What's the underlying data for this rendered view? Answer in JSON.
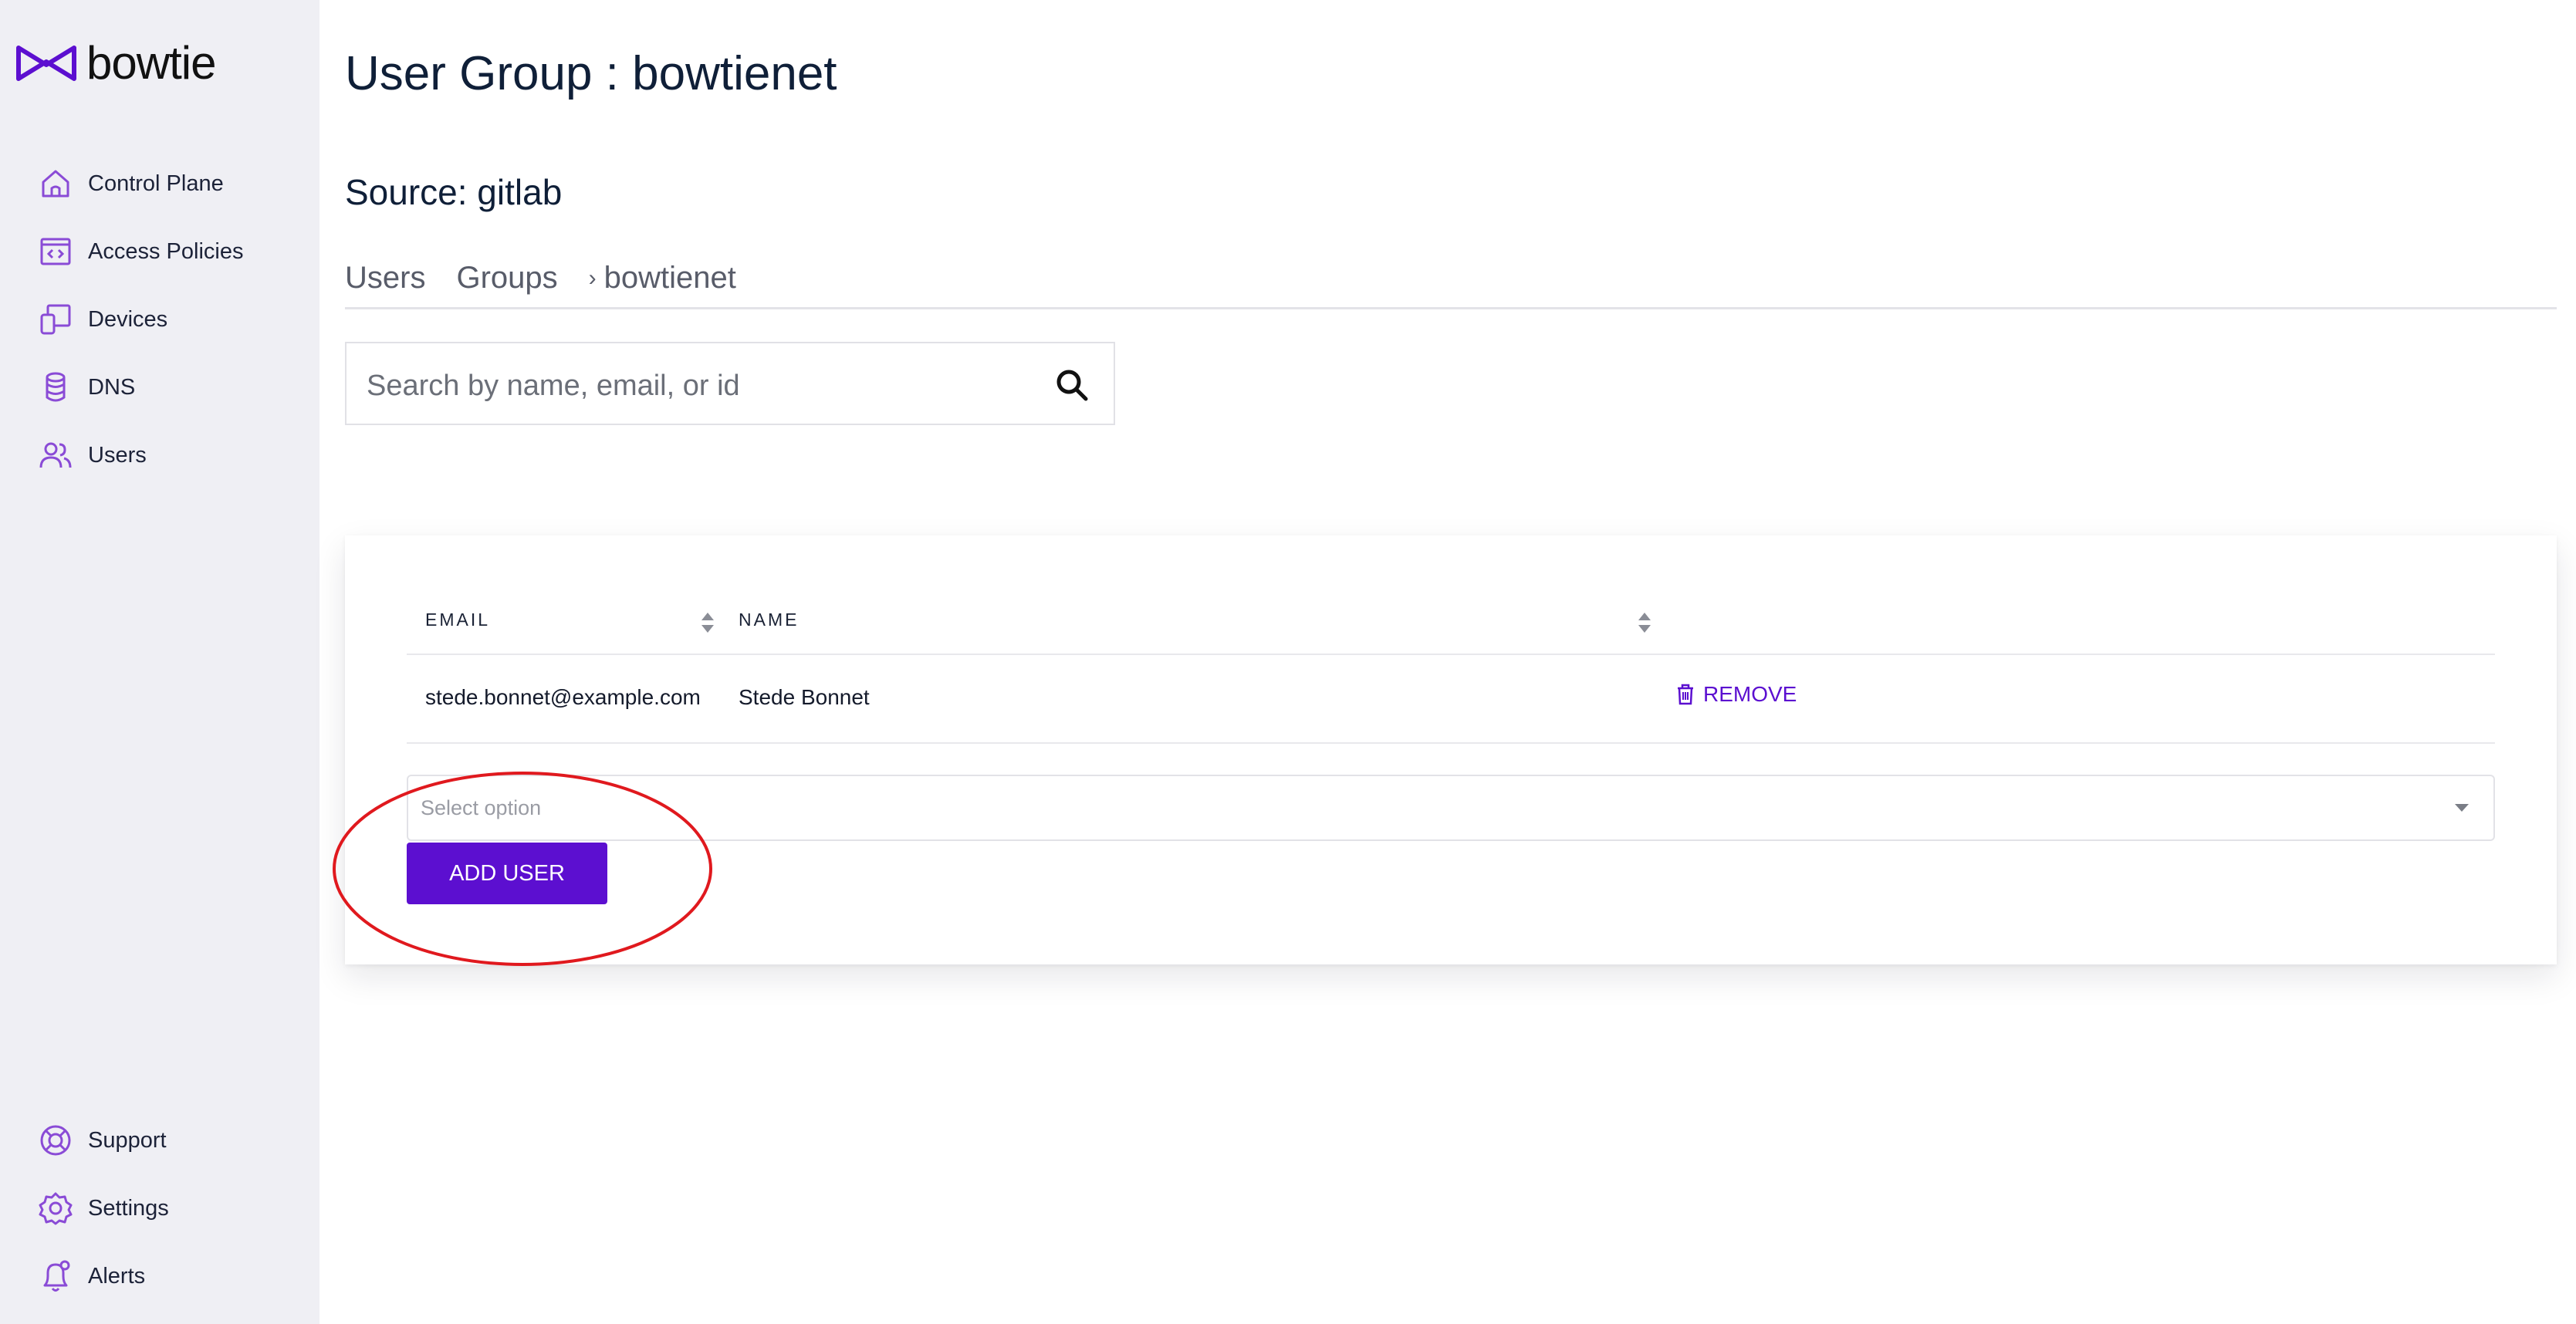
{
  "brand": {
    "name": "bowtie",
    "accent": "#5c0fd0",
    "icon_accent": "#8a4bd6"
  },
  "sidebar": {
    "items": [
      {
        "label": "Control Plane",
        "icon": "home-icon"
      },
      {
        "label": "Access Policies",
        "icon": "code-window-icon"
      },
      {
        "label": "Devices",
        "icon": "devices-icon"
      },
      {
        "label": "DNS",
        "icon": "database-icon"
      },
      {
        "label": "Users",
        "icon": "users-icon"
      }
    ],
    "bottom_items": [
      {
        "label": "Support",
        "icon": "lifebuoy-icon"
      },
      {
        "label": "Settings",
        "icon": "gear-icon"
      },
      {
        "label": "Alerts",
        "icon": "bell-icon"
      }
    ]
  },
  "main": {
    "title": "User Group : bowtienet",
    "source": "Source: gitlab",
    "tabs": [
      {
        "label": "Users"
      },
      {
        "label": "Groups"
      }
    ],
    "breadcrumb_current": "bowtienet",
    "search": {
      "placeholder": "Search by name, email, or id"
    }
  },
  "table": {
    "columns": [
      "EMAIL",
      "NAME"
    ],
    "rows": [
      {
        "email": "stede.bonnet@example.com",
        "name": "Stede Bonnet",
        "action": "REMOVE"
      }
    ]
  },
  "add_user": {
    "select_placeholder": "Select option",
    "button_label": "ADD USER",
    "highlight_color": "#e0191e"
  }
}
